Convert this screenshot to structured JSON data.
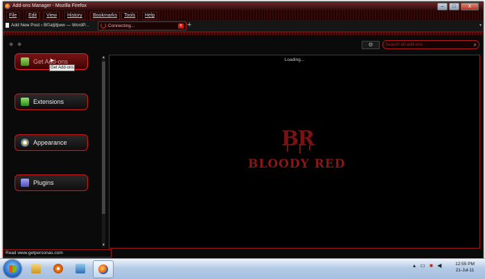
{
  "window": {
    "title": "Add-ons Manager - Mozilla Firefox",
    "controls": {
      "minimize": "–",
      "maximize": "□",
      "close": "X"
    }
  },
  "menubar": {
    "items": [
      "File",
      "Edit",
      "View",
      "History",
      "Bookmarks",
      "Tools",
      "Help"
    ]
  },
  "tabs": [
    {
      "label": "Add New Post ‹ B©a§l§ww — WordP..."
    },
    {
      "label": "Connecting...",
      "close": "x"
    }
  ],
  "new_tab_symbol": "+",
  "navigation": {
    "search_placeholder": "Search all add-ons",
    "gear_symbol": "⚙"
  },
  "sidebar": {
    "categories": [
      {
        "label": "Get Add-ons",
        "icon": "get-addons-icon",
        "selected": true
      },
      {
        "label": "Extensions",
        "icon": "puzzle-icon",
        "selected": false
      },
      {
        "label": "Appearance",
        "icon": "palette-icon",
        "selected": false
      },
      {
        "label": "Plugins",
        "icon": "plugin-icon",
        "selected": false
      }
    ],
    "tooltip": "Get Add-ons"
  },
  "content": {
    "loading_text": "Loading...",
    "logo": {
      "initials": "BR",
      "wordmark": "BLOODY RED"
    }
  },
  "statusbar": {
    "text": "Read www.getpersonas.com"
  },
  "taskbar": {
    "clock_time": "12:55 PM",
    "clock_date": "21-Jul-11"
  },
  "colors": {
    "accent": "#c41f1f",
    "background": "#0a0a0a",
    "taskbar": "#b4cbe6"
  }
}
